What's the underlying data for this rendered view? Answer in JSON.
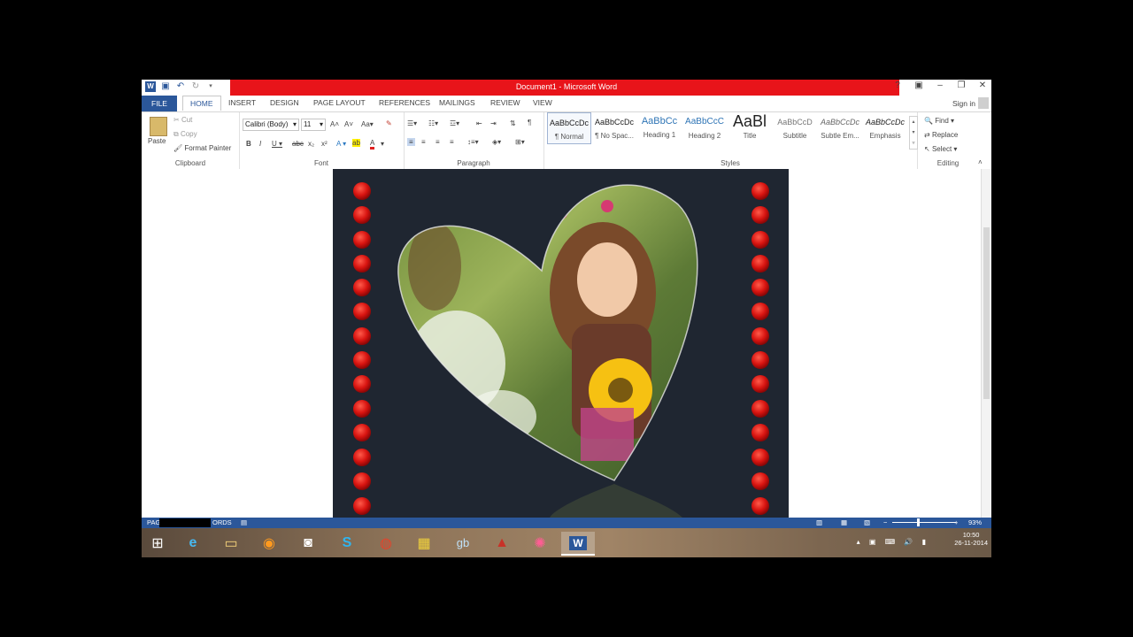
{
  "window": {
    "title": "Document1 - Microsoft Word",
    "controls": [
      "?",
      "▣",
      "–",
      "❐",
      "✕"
    ]
  },
  "tabs": [
    "FILE",
    "HOME",
    "INSERT",
    "DESIGN",
    "PAGE LAYOUT",
    "REFERENCES",
    "MAILINGS",
    "REVIEW",
    "VIEW"
  ],
  "signin": "Sign in",
  "clipboard": {
    "paste": "Paste",
    "cut": "Cut",
    "copy": "Copy",
    "format_painter": "Format Painter",
    "label": "Clipboard"
  },
  "font": {
    "name": "Calibri (Body)",
    "size": "11",
    "label": "Font"
  },
  "paragraph": {
    "label": "Paragraph"
  },
  "styles": {
    "label": "Styles",
    "items": [
      {
        "preview": "AaBbCcDc",
        "name": "¶ Normal"
      },
      {
        "preview": "AaBbCcDc",
        "name": "¶ No Spac..."
      },
      {
        "preview": "AaBbCc",
        "name": "Heading 1"
      },
      {
        "preview": "AaBbCcC",
        "name": "Heading 2"
      },
      {
        "preview": "AaBl",
        "name": "Title"
      },
      {
        "preview": "AaBbCcD",
        "name": "Subtitle"
      },
      {
        "preview": "AaBbCcDc",
        "name": "Subtle Em..."
      },
      {
        "preview": "AaBbCcDc",
        "name": "Emphasis"
      }
    ]
  },
  "editing": {
    "find": "Find",
    "replace": "Replace",
    "select": "Select",
    "label": "Editing"
  },
  "statusbar": {
    "left": "PAG",
    "words": "ORDS",
    "zoom": "93%"
  },
  "taskbar": {
    "time": "10:50",
    "date": "26-11-2014"
  },
  "colors": {
    "accent": "#2b579a",
    "titlebar_red": "#e8141a",
    "artwork_bg": "#1f2631"
  }
}
